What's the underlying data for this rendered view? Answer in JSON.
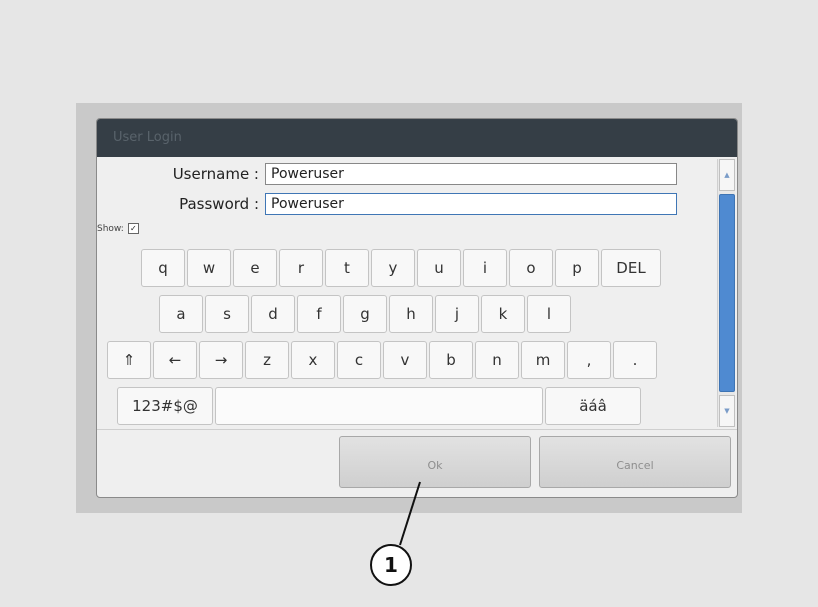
{
  "dialog": {
    "title": "User Login",
    "username_label": "Username :",
    "username_value": "Poweruser",
    "password_label": "Password :",
    "password_value": "Poweruser",
    "show_label": "Show:",
    "show_checked": "✓"
  },
  "keyboard": {
    "row1": [
      "q",
      "w",
      "e",
      "r",
      "t",
      "y",
      "u",
      "i",
      "o",
      "p",
      "DEL"
    ],
    "row2": [
      "a",
      "s",
      "d",
      "f",
      "g",
      "h",
      "j",
      "k",
      "l"
    ],
    "row3": [
      "⇑",
      "←",
      "→",
      "z",
      "x",
      "c",
      "v",
      "b",
      "n",
      "m",
      ",",
      "."
    ],
    "mode_symbols": "123#$@",
    "mode_accents": "äáâ"
  },
  "buttons": {
    "ok": "Ok",
    "cancel": "Cancel"
  },
  "scrollbar": {
    "up_icon": "▲",
    "down_icon": "▼"
  },
  "callout": {
    "number": "1"
  },
  "colors": {
    "titlebar": "#353e46",
    "scroll_thumb": "#4f8ad1",
    "field_focus": "#3f76b5"
  }
}
